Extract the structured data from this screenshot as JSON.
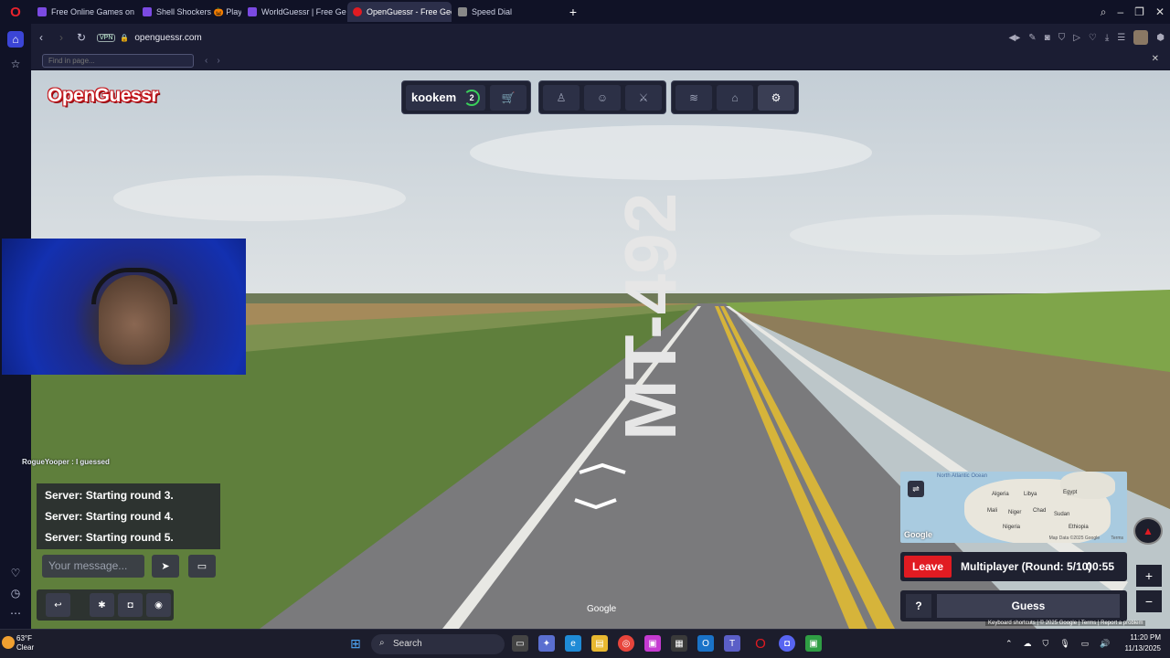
{
  "browser": {
    "tabs": [
      {
        "title": "Free Online Games on Cra",
        "active": false
      },
      {
        "title": "Shell Shockers 🎃 Play on",
        "active": false
      },
      {
        "title": "WorldGuessr | Free GeoGu",
        "active": false
      },
      {
        "title": "OpenGuessr - Free GeoGu",
        "active": true
      },
      {
        "title": "Speed Dial",
        "active": false
      }
    ],
    "url": "openguessr.com",
    "vpn_label": "VPN",
    "find_placeholder": "Find in page..."
  },
  "game": {
    "logo": "OpenGuessr",
    "username": "kookem",
    "level": "2",
    "road_label": "MT-492",
    "google_watermark": "Google",
    "chat": {
      "last_sender_line": "RogueYooper : I guessed",
      "messages": [
        "Server: Starting round 3.",
        "Server: Starting round 4.",
        "Server: Starting round 5."
      ],
      "input_placeholder": "Your message..."
    },
    "minimap": {
      "labels": [
        "Algeria",
        "Libya",
        "Egypt",
        "Mali",
        "Niger",
        "Chad",
        "Sudan",
        "Nigeria",
        "Ethiopia",
        "North Atlantic Ocean"
      ],
      "credit": "Map Data ©2025 Google",
      "terms": "Terms",
      "google_logo": "Google"
    },
    "status": {
      "leave_label": "Leave",
      "round_text": "Multiplayer (Round: 5/10)",
      "timer": "00:55"
    },
    "help_label": "?",
    "guess_label": "Guess",
    "footer_links": [
      "Keyboard shortcuts",
      "© 2025 Google",
      "Terms",
      "Report a problem"
    ]
  },
  "taskbar": {
    "temperature": "63°F",
    "weather": "Clear",
    "search_label": "Search",
    "time": "11:20 PM",
    "date": "11/13/2025"
  }
}
